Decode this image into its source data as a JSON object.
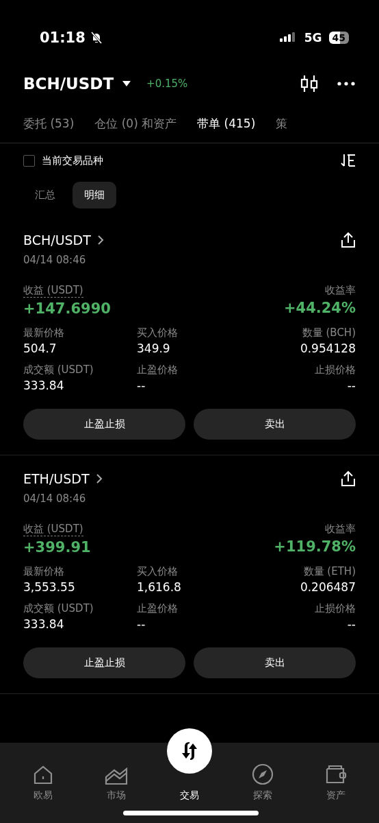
{
  "status_bar": {
    "time": "01:18",
    "network": "5G",
    "battery": "45",
    "silent": true
  },
  "header": {
    "pair": "BCH/USDT",
    "change": "+0.15%"
  },
  "tabs": [
    {
      "label": "委托 (53)",
      "selected": false
    },
    {
      "label": "仓位 (0) 和资产",
      "selected": false
    },
    {
      "label": "带单 (415)",
      "selected": true
    },
    {
      "label": "策",
      "selected": false
    }
  ],
  "filter": {
    "label": "当前交易品种",
    "checked": false
  },
  "segments": [
    {
      "label": "汇总",
      "selected": false
    },
    {
      "label": "明细",
      "selected": true
    }
  ],
  "cards": [
    {
      "pair": "BCH/USDT",
      "time": "04/14 08:46",
      "profit_label": "收益 (USDT)",
      "profit": "+147.6990",
      "rate_label": "收益率",
      "rate": "+44.24%",
      "fields": [
        {
          "label": "最新价格",
          "value": "504.7"
        },
        {
          "label": "买入价格",
          "value": "349.9"
        },
        {
          "label": "数量 (BCH)",
          "value": "0.954128"
        },
        {
          "label": "成交额 (USDT)",
          "value": "333.84"
        },
        {
          "label": "止盈价格",
          "value": "--"
        },
        {
          "label": "止损价格",
          "value": "--"
        }
      ],
      "buttons": [
        "止盈止损",
        "卖出"
      ]
    },
    {
      "pair": "ETH/USDT",
      "time": "04/14 08:46",
      "profit_label": "收益 (USDT)",
      "profit": "+399.91",
      "rate_label": "收益率",
      "rate": "+119.78%",
      "fields": [
        {
          "label": "最新价格",
          "value": "3,553.55"
        },
        {
          "label": "买入价格",
          "value": "1,616.8"
        },
        {
          "label": "数量 (ETH)",
          "value": "0.206487"
        },
        {
          "label": "成交额 (USDT)",
          "value": "333.84"
        },
        {
          "label": "止盈价格",
          "value": "--"
        },
        {
          "label": "止损价格",
          "value": "--"
        }
      ],
      "buttons": [
        "止盈止损",
        "卖出"
      ]
    }
  ],
  "nav": [
    {
      "label": "欧易",
      "selected": false
    },
    {
      "label": "市场",
      "selected": false
    },
    {
      "label": "交易",
      "selected": true
    },
    {
      "label": "探索",
      "selected": false
    },
    {
      "label": "资产",
      "selected": false
    }
  ]
}
